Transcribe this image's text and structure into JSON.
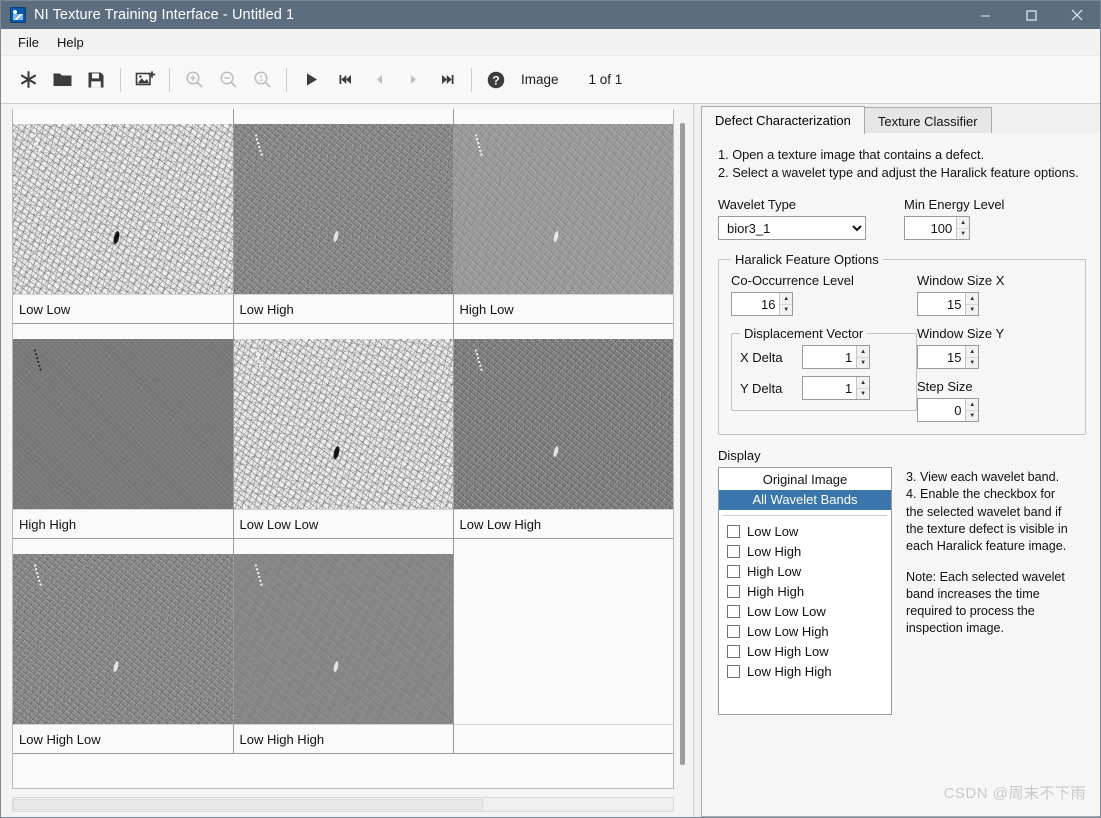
{
  "window": {
    "title": "NI Texture Training Interface - Untitled 1",
    "icon": "image-app-icon",
    "titlebar_color": "#5d6d80",
    "minimize_label": "Minimize",
    "maximize_label": "Maximize",
    "close_label": "Close"
  },
  "menubar": {
    "items": [
      {
        "label": "File"
      },
      {
        "label": "Help"
      }
    ]
  },
  "toolbar": {
    "buttons": [
      {
        "name": "new-button",
        "icon": "asterisk-new-icon",
        "enabled": true
      },
      {
        "name": "open-button",
        "icon": "folder-open-icon",
        "enabled": true
      },
      {
        "name": "save-button",
        "icon": "floppy-save-icon",
        "enabled": true
      },
      {
        "name": "add-image-button",
        "icon": "add-image-icon",
        "enabled": true
      },
      {
        "name": "zoom-in-button",
        "icon": "magnifier-plus-icon",
        "enabled": false
      },
      {
        "name": "zoom-out-button",
        "icon": "magnifier-minus-icon",
        "enabled": false
      },
      {
        "name": "zoom-actual-button",
        "icon": "magnifier-one-icon",
        "enabled": false
      },
      {
        "name": "play-button",
        "icon": "play-triangle-icon",
        "enabled": true
      },
      {
        "name": "first-image-button",
        "icon": "skip-first-icon",
        "enabled": true
      },
      {
        "name": "previous-image-button",
        "icon": "arrow-left-icon",
        "enabled": false
      },
      {
        "name": "next-image-button",
        "icon": "arrow-right-icon",
        "enabled": false
      },
      {
        "name": "last-image-button",
        "icon": "skip-last-icon",
        "enabled": true
      },
      {
        "name": "help-button",
        "icon": "question-circle-icon",
        "enabled": true
      }
    ],
    "image_label": "Image",
    "image_counter": "1 of  1"
  },
  "image_grid": {
    "cells": [
      {
        "label": "Low Low",
        "texture": "light",
        "defect": "dark",
        "scratch": "light"
      },
      {
        "label": "Low High",
        "texture": "mid",
        "defect": "soft",
        "scratch": "light"
      },
      {
        "label": "High Low",
        "texture": "midlight",
        "defect": "soft",
        "scratch": "light"
      },
      {
        "label": "High High",
        "texture": "flat",
        "defect": "none",
        "scratch": "dark"
      },
      {
        "label": "Low Low Low",
        "texture": "light",
        "defect": "dark",
        "scratch": "light"
      },
      {
        "label": "Low Low High",
        "texture": "middark",
        "defect": "soft",
        "scratch": "light"
      },
      {
        "label": "Low High Low",
        "texture": "mid",
        "defect": "soft",
        "scratch": "light"
      },
      {
        "label": "Low High High",
        "texture": "smooth",
        "defect": "soft",
        "scratch": "light"
      },
      {
        "label": "",
        "texture": "none",
        "defect": "none",
        "scratch": "none"
      }
    ]
  },
  "tabs": [
    {
      "label": "Defect Characterization",
      "active": true
    },
    {
      "label": "Texture Classifier",
      "active": false
    }
  ],
  "defect_panel": {
    "instructions_top": "1. Open a texture image that contains a defect.\n2. Select a wavelet type and adjust the Haralick feature options.",
    "wavelet_type": {
      "label": "Wavelet Type",
      "value": "bior3_1",
      "options": [
        "bior3_1"
      ]
    },
    "min_energy_level": {
      "label": "Min Energy Level",
      "value": "100"
    },
    "haralick": {
      "legend": "Haralick Feature Options",
      "co_occurrence_level": {
        "label": "Co-Occurrence Level",
        "value": "16"
      },
      "displacement_vector": {
        "legend": "Displacement Vector",
        "x_delta": {
          "label": "X Delta",
          "value": "1"
        },
        "y_delta": {
          "label": "Y Delta",
          "value": "1"
        }
      },
      "window_size_x": {
        "label": "Window Size X",
        "value": "15"
      },
      "window_size_y": {
        "label": "Window Size Y",
        "value": "15"
      },
      "step_size": {
        "label": "Step Size",
        "value": "0"
      }
    },
    "display": {
      "label": "Display",
      "list_items": [
        {
          "label": "Original Image",
          "selected": false
        },
        {
          "label": "All Wavelet Bands",
          "selected": true
        }
      ],
      "selection_color": "#3a76ab",
      "checkboxes": [
        {
          "label": "Low Low",
          "checked": false
        },
        {
          "label": "Low High",
          "checked": false
        },
        {
          "label": "High Low",
          "checked": false
        },
        {
          "label": "High High",
          "checked": false
        },
        {
          "label": "Low Low Low",
          "checked": false
        },
        {
          "label": "Low Low High",
          "checked": false
        },
        {
          "label": "Low High Low",
          "checked": false
        },
        {
          "label": "Low High High",
          "checked": false
        }
      ]
    },
    "instructions_side": "3. View each wavelet band.\n4. Enable the checkbox for the selected wavelet band if the texture defect is visible in each Haralick feature image.",
    "note_side": "Note: Each selected wavelet band increases the time required to process the inspection image."
  },
  "watermark": "CSDN @周末不下雨"
}
